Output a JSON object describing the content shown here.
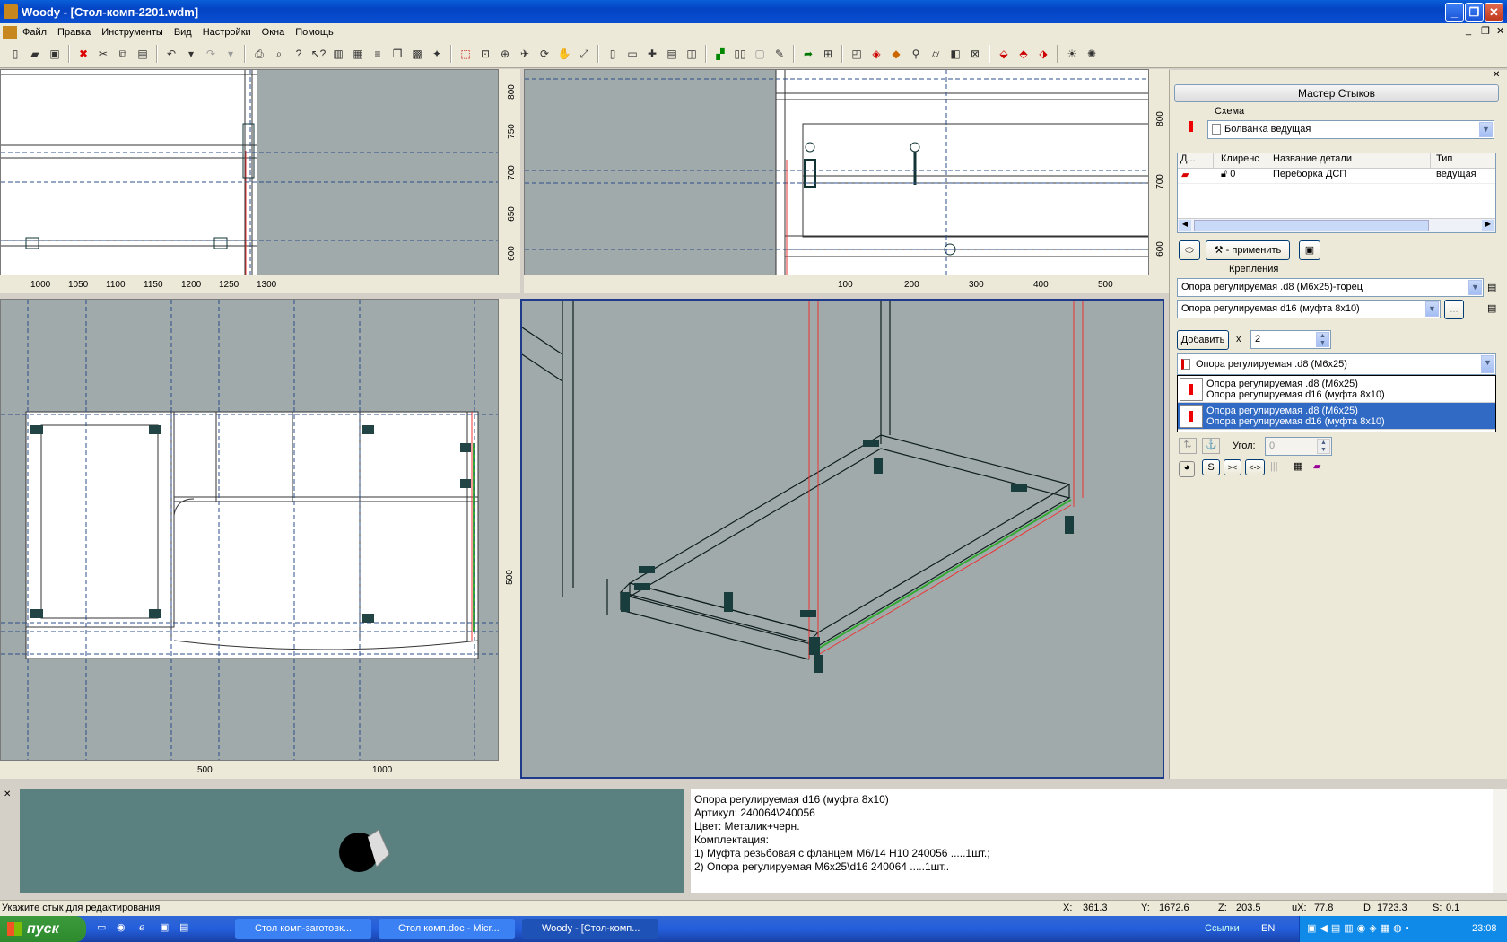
{
  "window": {
    "title": "Woody - [Стол-комп-2201.wdm]"
  },
  "menu": [
    "Файл",
    "Правка",
    "Инструменты",
    "Вид",
    "Настройки",
    "Окна",
    "Помощь"
  ],
  "views": {
    "top_left_ticks_x": [
      "1000",
      "1050",
      "1100",
      "1150",
      "1200",
      "1250",
      "1300"
    ],
    "top_left_ticks_y": [
      "800",
      "750",
      "700",
      "650",
      "600"
    ],
    "top_right_ticks_x": [
      "100",
      "200",
      "300",
      "400",
      "500"
    ],
    "top_right_ticks_y": [
      "800",
      "700",
      "600"
    ],
    "bottom_left_ticks_x": [
      "500",
      "1000"
    ],
    "bottom_left_ticks_y": [
      "500"
    ]
  },
  "panel": {
    "title": "Мастер Стыков",
    "scheme_label": "Схема",
    "scheme_value": "Болванка ведущая",
    "table": {
      "headers": [
        "Д...",
        "Клиренс",
        "Название детали",
        "Тип"
      ],
      "rows": [
        {
          "clearance": "0",
          "name": "Переборка ДСП",
          "type": "ведущая"
        }
      ]
    },
    "apply_label": "- применить",
    "fasteners_label": "Крепления",
    "fastener1": "Опора регулируемая .d8 (М6х25)-торец",
    "fastener2": "Опора регулируемая d16 (муфта 8х10)",
    "add_label": "Добавить",
    "times": "x",
    "count": "2",
    "dropdown_value": "Опора регулируемая .d8 (М6х25)",
    "dropdown_items": [
      {
        "line1": "Опора регулируемая .d8 (М6х25)",
        "line2": "Опора регулируемая d16 (муфта 8х10)",
        "selected": false
      },
      {
        "line1": "Опора регулируемая .d8 (М6х25)",
        "line2": "Опора регулируемая d16 (муфта 8х10)",
        "selected": true
      }
    ],
    "angle_label": "Угол:",
    "angle_value": "0",
    "btn_s": "S",
    "btn_in": "><",
    "btn_out": "<->"
  },
  "info": {
    "lines": [
      "Опора регулируемая d16 (муфта 8х10)",
      "Артикул: 240064\\240056",
      "Цвет: Металик+черн.",
      "Комплектация:",
      "1) Муфта резьбовая с фланцем М6/14 Н10 240056 .....1шт.;",
      "2) Опора регулируемая М6х25\\d16 240064 .....1шт.."
    ]
  },
  "status": {
    "hint": "Укажите стык для редактирования",
    "x_label": "X:",
    "x": "361.3",
    "y_label": "Y:",
    "y": "1672.6",
    "z_label": "Z:",
    "z": "203.5",
    "ux_label": "uX:",
    "ux": "77.8",
    "d_label": "D:",
    "d": "1723.3",
    "s_label": "S:",
    "s": "0.1"
  },
  "taskbar": {
    "start": "пуск",
    "tasks": [
      "Стол комп-заготовк...",
      "Стол комп.doc - Micr...",
      "Woody - [Стол-комп..."
    ],
    "links": "Ссылки",
    "lang": "EN",
    "clock": "23:08"
  }
}
